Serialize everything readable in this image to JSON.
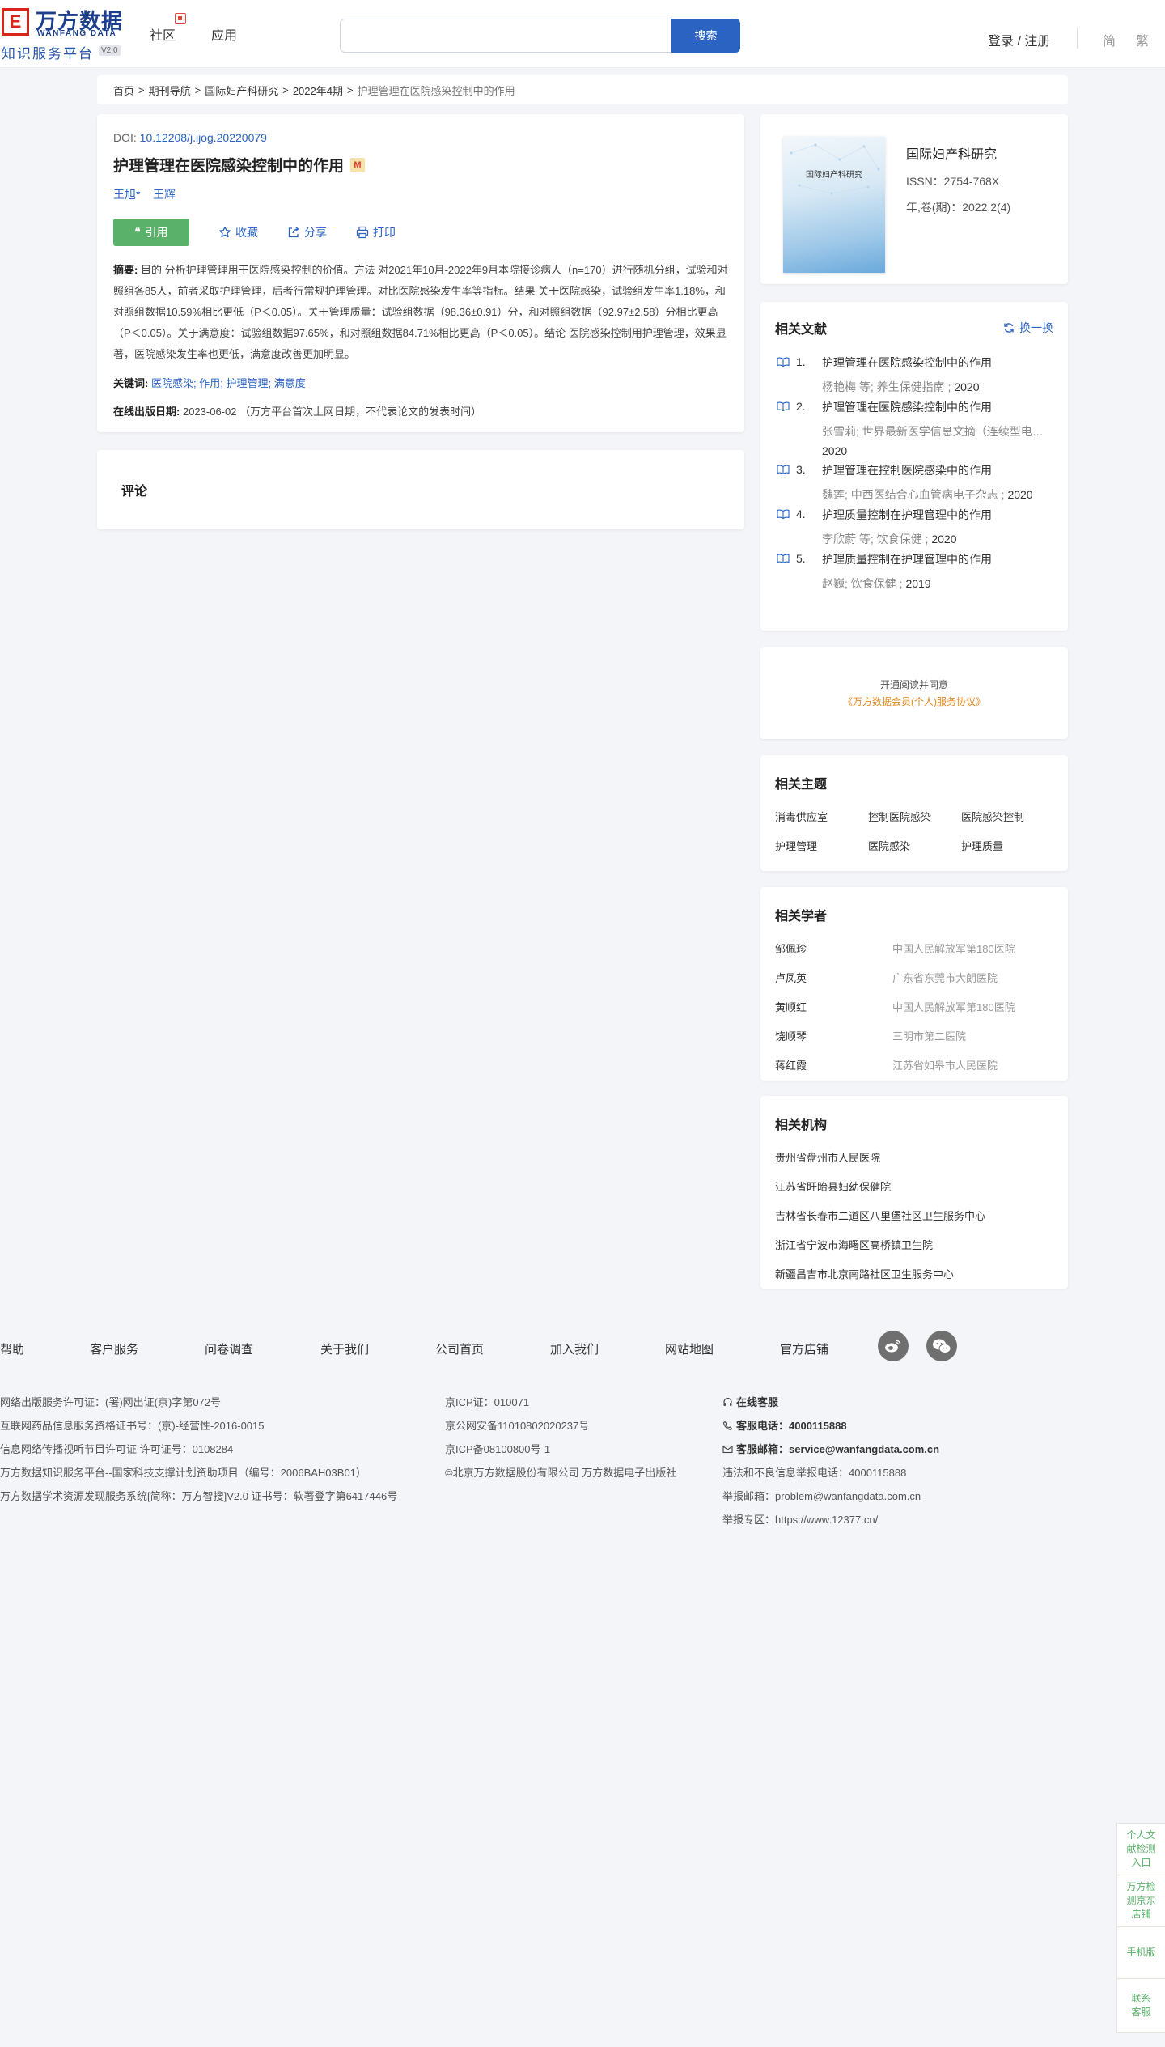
{
  "header": {
    "logo_cn": "万方数据",
    "logo_en": "WANFANG DATA",
    "logo_sub": "知识服务平台",
    "logo_version": "V2.0",
    "nav": [
      "社区",
      "应用"
    ],
    "search_placeholder": "",
    "search_button": "搜索",
    "login": "登录 / 注册",
    "lang_simplified": "简",
    "lang_traditional": "繁"
  },
  "breadcrumb": {
    "items": [
      "首页",
      "期刊导航",
      "国际妇产科研究",
      "2022年4期"
    ],
    "current": "护理管理在医院感染控制中的作用"
  },
  "article": {
    "doi_label": "DOI: ",
    "doi": "10.12208/j.ijog.20220079",
    "title": "护理管理在医院感染控制中的作用",
    "badge": "M",
    "authors": [
      "王旭*",
      "王辉"
    ],
    "cite_label": "引用",
    "favorite_label": "收藏",
    "share_label": "分享",
    "print_label": "打印",
    "abstract_label": "摘要:",
    "abstract": "目的 分析护理管理用于医院感染控制的价值。方法 对2021年10月-2022年9月本院接诊病人（n=170）进行随机分组，试验和对照组各85人，前者采取护理管理，后者行常规护理管理。对比医院感染发生率等指标。结果 关于医院感染，试验组发生率1.18%，和对照组数据10.59%相比更低（P＜0.05）。关于管理质量：试验组数据（98.36±0.91）分，和对照组数据（92.97±2.58）分相比更高（P＜0.05）。关于满意度：试验组数据97.65%，和对照组数据84.71%相比更高（P＜0.05）。结论 医院感染控制用护理管理，效果显著，医院感染发生率也更低，满意度改善更加明显。",
    "keywords_label": "关键词:",
    "keywords": [
      "医院感染;",
      "作用;",
      "护理管理;",
      "满意度"
    ],
    "pubdate_label": "在线出版日期:",
    "pubdate": "2023-06-02 （万方平台首次上网日期，不代表论文的发表时间）"
  },
  "comment": {
    "title": "评论"
  },
  "journal": {
    "cover_title": "国际妇产科研究",
    "name": "国际妇产科研究",
    "issn": "ISSN：2754-768X",
    "volume": "年,卷(期)：2022,2(4)"
  },
  "related_docs": {
    "title": "相关文献",
    "refresh": "换一换",
    "items": [
      {
        "num": "1.",
        "title": "护理管理在医院感染控制中的作用",
        "meta": "杨艳梅 等; 养生保健指南 ; ",
        "year": "2020"
      },
      {
        "num": "2.",
        "title": "护理管理在医院感染控制中的作用",
        "meta": "张雪莉; 世界最新医学信息文摘（连续型电子期刊）; ",
        "year": "2020"
      },
      {
        "num": "3.",
        "title": "护理管理在控制医院感染中的作用",
        "meta": "魏莲; 中西医结合心血管病电子杂志 ; ",
        "year": "2020"
      },
      {
        "num": "4.",
        "title": "护理质量控制在护理管理中的作用",
        "meta": "李欣蔚 等; 饮食保健 ; ",
        "year": "2020"
      },
      {
        "num": "5.",
        "title": "护理质量控制在护理管理中的作用",
        "meta": "赵巍; 饮食保健 ; ",
        "year": "2019"
      }
    ]
  },
  "agreement": {
    "line1": "开通阅读并同意",
    "line2": "《万方数据会员(个人)服务协议》"
  },
  "topics": {
    "title": "相关主题",
    "items": [
      "消毒供应室",
      "控制医院感染",
      "医院感染控制",
      "护理管理",
      "医院感染",
      "护理质量"
    ]
  },
  "scholars": {
    "title": "相关学者",
    "items": [
      {
        "name": "邹佩珍",
        "org": "中国人民解放军第180医院"
      },
      {
        "name": "卢凤英",
        "org": "广东省东莞市大朗医院"
      },
      {
        "name": "黄顺红",
        "org": "中国人民解放军第180医院"
      },
      {
        "name": "饶顺琴",
        "org": "三明市第二医院"
      },
      {
        "name": "蒋红霞",
        "org": "江苏省如皋市人民医院"
      }
    ]
  },
  "institutions": {
    "title": "相关机构",
    "items": [
      "贵州省盘州市人民医院",
      "江苏省盱眙县妇幼保健院",
      "吉林省长春市二道区八里堡社区卫生服务中心",
      "浙江省宁波市海曙区高桥镇卫生院",
      "新疆昌吉市北京南路社区卫生服务中心"
    ]
  },
  "footer": {
    "links": [
      "帮助",
      "客户服务",
      "问卷调查",
      "关于我们",
      "公司首页",
      "加入我们",
      "网站地图",
      "官方店铺"
    ],
    "col1": [
      "网络出版服务许可证：(署)网出证(京)字第072号",
      "互联网药品信息服务资格证书号：(京)-经营性-2016-0015",
      "信息网络传播视听节目许可证 许可证号：0108284",
      "万方数据知识服务平台--国家科技支撑计划资助项目（编号：2006BAH03B01）",
      "万方数据学术资源发现服务系统[简称：万方智搜]V2.0 证书号：软著登字第6417446号"
    ],
    "col2": [
      "京ICP证：010071",
      "京公网安备11010802020237号",
      "京ICP备08100800号-1",
      "©北京万方数据股份有限公司 万方数据电子出版社"
    ],
    "online_service": "在线客服",
    "phone_label": "客服电话：",
    "phone": "4000115888",
    "email_label": "客服邮箱：",
    "email": "service@wanfangdata.com.cn",
    "report_phone": "违法和不良信息举报电话：4000115888",
    "report_email": "举报邮箱：problem@wanfangdata.com.cn",
    "report_zone": "举报专区：https://www.12377.cn/"
  },
  "side_float": [
    "个人文献检测入口",
    "万方检测京东店铺",
    "手机版",
    "联系客服"
  ],
  "colors": {
    "primary": "#2a63c2",
    "cite_green": "#5ab16a",
    "brand_red": "#d9261c",
    "agreement_orange": "#e08a1e"
  }
}
